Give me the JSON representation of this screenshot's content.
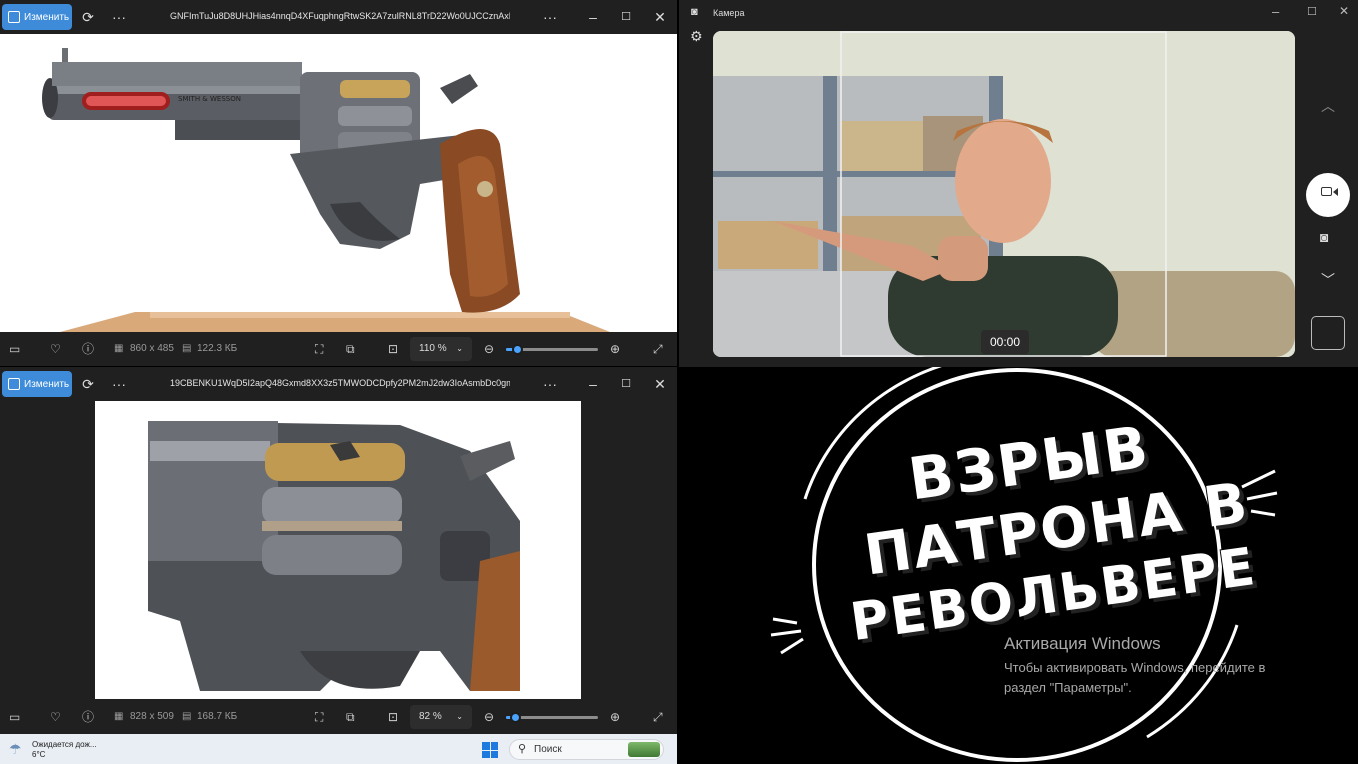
{
  "viewer_top": {
    "edit_label": "Изменить",
    "file_name": "GNFImTuJu8D8UHJHias4nnqD4XFuqphngRtwSK2A7zulRNL8TrD22Wo0UJCCznAxETxg7...",
    "dimensions": "860 x 485",
    "file_size": "122.3 КБ",
    "zoom": "110 %",
    "zoom_level": 0.12
  },
  "viewer_bottom": {
    "edit_label": "Изменить",
    "file_name": "19CBENKU1WqD5I2apQ48Gxmd8XX3z5TMWODCDpfy2PM2mJ2dw3IoAsmbDc0gmzsP1...",
    "dimensions": "828 x 509",
    "file_size": "168.7 КБ",
    "zoom": "82 %",
    "zoom_level": 0.1
  },
  "camera": {
    "title": "Камера",
    "timer": "00:00"
  },
  "taskbar": {
    "weather_line1": "Ожидается дож...",
    "weather_line2": "6°C",
    "search_placeholder": "Поиск"
  },
  "title_card": {
    "line1": "ВЗРЫВ",
    "line2": "ПАТРОНА В",
    "line3": "РЕВОЛЬВЕРЕ"
  },
  "watermark": {
    "title": "Активация Windows",
    "line1": "Чтобы активировать Windows, перейдите в",
    "line2": "раздел \"Параметры\"."
  },
  "colors": {
    "accent": "#3d8bd9",
    "window_bg": "#202020",
    "slider": "#4aa3ff"
  }
}
